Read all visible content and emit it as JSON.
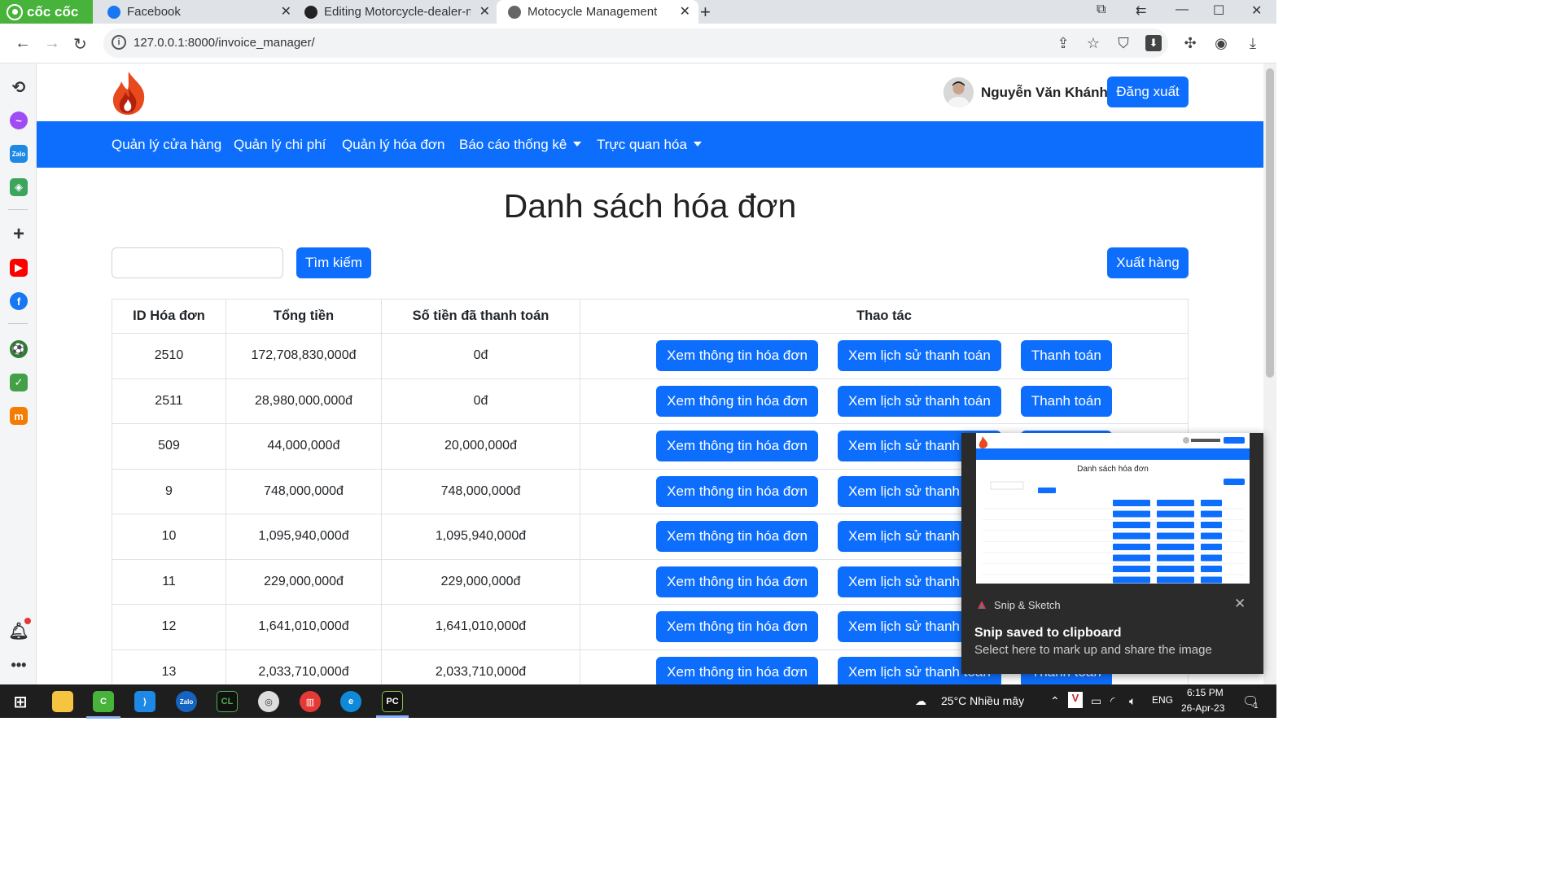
{
  "browser": {
    "brand": "cốc cốc",
    "tabs": [
      {
        "title": "Facebook"
      },
      {
        "title": "Editing Motorcycle-dealer-m"
      },
      {
        "title": "Motocycle Management"
      }
    ],
    "url": "127.0.0.1:8000/invoice_manager/"
  },
  "header": {
    "user_name": "Nguyễn Văn Khánh",
    "logout_label": "Đăng xuất"
  },
  "nav": {
    "items": [
      {
        "label": "Quản lý cửa hàng"
      },
      {
        "label": "Quản lý chi phí"
      },
      {
        "label": "Quản lý hóa đơn"
      },
      {
        "label": "Báo cáo thống kê"
      },
      {
        "label": "Trực quan hóa"
      }
    ]
  },
  "main": {
    "title": "Danh sách hóa đơn",
    "search_value": "",
    "search_button": "Tìm kiếm",
    "export_button": "Xuất hàng"
  },
  "table": {
    "headers": [
      "ID Hóa đơn",
      "Tổng tiền",
      "Số tiền đã thanh toán",
      "Thao tác"
    ],
    "action_labels": {
      "view": "Xem thông tin hóa đơn",
      "history": "Xem lịch sử thanh toán",
      "pay": "Thanh toán"
    },
    "rows": [
      {
        "id": "2510",
        "total": "172,708,830,000đ",
        "paid": "0đ"
      },
      {
        "id": "2511",
        "total": "28,980,000,000đ",
        "paid": "0đ"
      },
      {
        "id": "509",
        "total": "44,000,000đ",
        "paid": "20,000,000đ"
      },
      {
        "id": "9",
        "total": "748,000,000đ",
        "paid": "748,000,000đ"
      },
      {
        "id": "10",
        "total": "1,095,940,000đ",
        "paid": "1,095,940,000đ"
      },
      {
        "id": "11",
        "total": "229,000,000đ",
        "paid": "229,000,000đ"
      },
      {
        "id": "12",
        "total": "1,641,010,000đ",
        "paid": "1,641,010,000đ"
      },
      {
        "id": "13",
        "total": "2,033,710,000đ",
        "paid": "2,033,710,000đ"
      }
    ]
  },
  "notification": {
    "app": "Snip & Sketch",
    "title": "Snip saved to clipboard",
    "message": "Select here to mark up and share the image",
    "preview_title": "Danh sách hóa đơn"
  },
  "taskbar": {
    "weather": "25°C  Nhiều mây",
    "language": "ENG",
    "time": "6:15 PM",
    "date": "26-Apr-23",
    "notification_count": "1"
  },
  "colors": {
    "primary": "#0d6efd",
    "brand_green": "#47b33a",
    "toast_bg": "#2b2b2b",
    "taskbar_bg": "#1e1e1e"
  }
}
